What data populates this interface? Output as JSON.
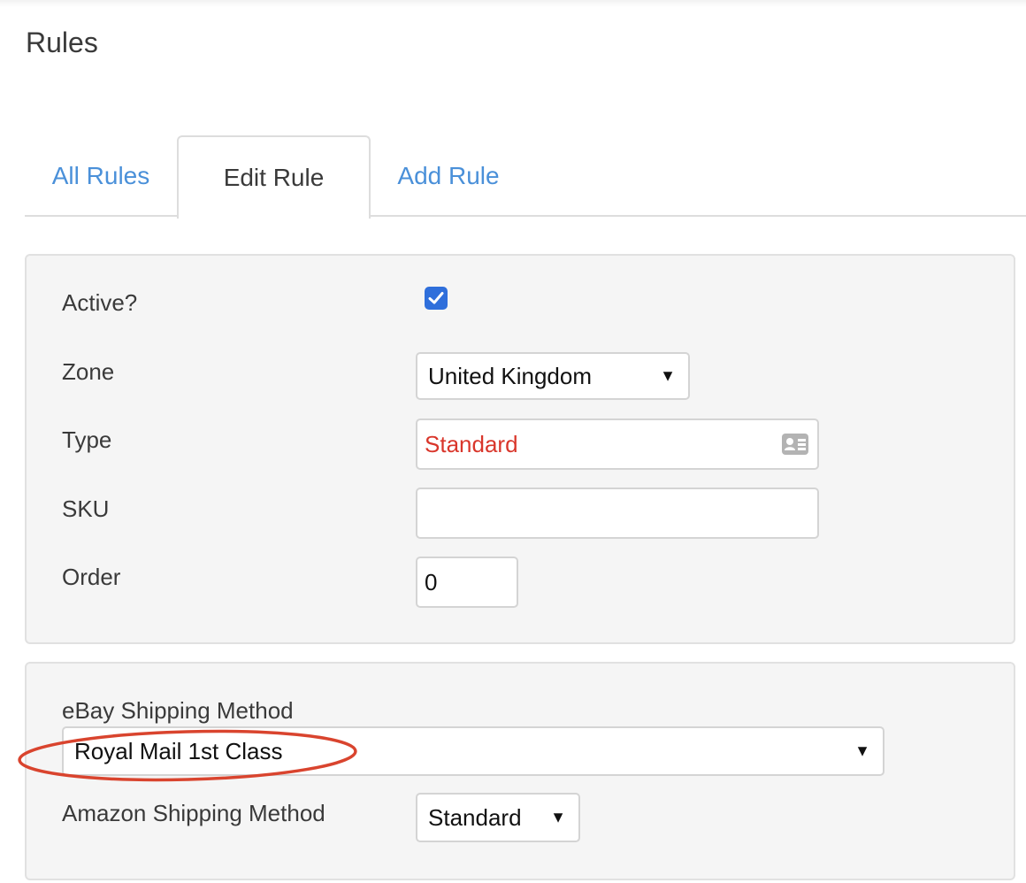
{
  "page": {
    "title": "Rules"
  },
  "tabs": [
    {
      "label": "All Rules",
      "active": false
    },
    {
      "label": "Edit Rule",
      "active": true
    },
    {
      "label": "Add Rule",
      "active": false
    }
  ],
  "rule_form": {
    "active": {
      "label": "Active?",
      "checked": true
    },
    "zone": {
      "label": "Zone",
      "value": "United Kingdom"
    },
    "type": {
      "label": "Type",
      "value": "Standard"
    },
    "sku": {
      "label": "SKU",
      "value": ""
    },
    "order": {
      "label": "Order",
      "value": "0"
    }
  },
  "shipping_form": {
    "ebay": {
      "label": "eBay Shipping Method",
      "value": "Royal Mail 1st Class"
    },
    "amazon": {
      "label": "Amazon Shipping Method",
      "value": "Standard"
    }
  },
  "icons": {
    "dropdown_caret": "▼",
    "checkmark": "check-icon",
    "contact_card": "contact-card-icon"
  },
  "colors": {
    "link": "#4a90d9",
    "checkbox": "#2f6fdb",
    "type_text": "#d9362b",
    "highlight_ellipse": "#d9442e"
  }
}
